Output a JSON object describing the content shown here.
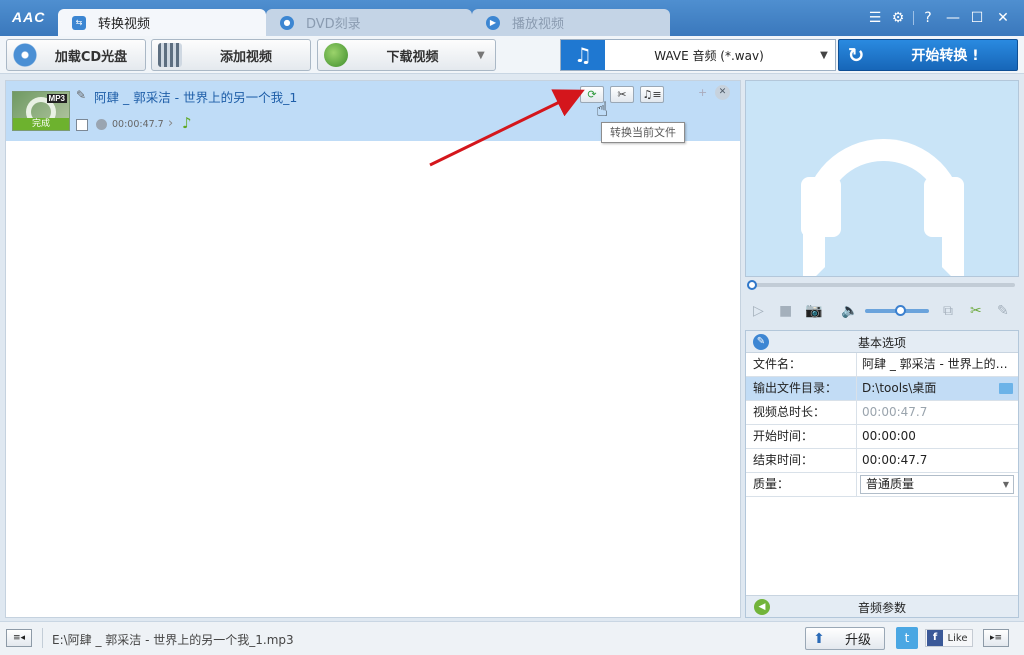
{
  "app": {
    "logo": "AAC"
  },
  "tabs": [
    {
      "label": "转换视频",
      "active": true
    },
    {
      "label": "DVD刻录",
      "active": false
    },
    {
      "label": "播放视频",
      "active": false
    }
  ],
  "window_controls": {
    "menu_glyph": "☰",
    "settings_glyph": "⚙",
    "help_glyph": "?",
    "minimize_glyph": "—",
    "maximize_glyph": "☐",
    "close_glyph": "✕"
  },
  "toolbar": {
    "load_cd_label": "加载CD光盘",
    "add_video_label": "添加视频",
    "download_video_label": "下载视频",
    "format_icon": "♫",
    "format_selected": "WAVE 音频 (*.wav)",
    "start_icon": "↻",
    "start_label": "开始转换 !"
  },
  "file_item": {
    "title": "阿肆 _ 郭采洁 - 世界上的另一个我_1",
    "format_badge": "MP3",
    "status": "完成",
    "duration": "00:00:47.7",
    "buttons": {
      "convert_glyph": "⟳",
      "cut_glyph": "✂",
      "audio_glyph": "♫≡",
      "add_glyph": "+",
      "close_glyph": "✕"
    },
    "tooltip": "转换当前文件"
  },
  "player": {
    "play_glyph": "▷",
    "stop_glyph": "■",
    "snapshot_glyph": "📷",
    "volume_glyph": "🔈",
    "volume_level": 0.55
  },
  "properties": {
    "header": "基本选项",
    "rows": [
      {
        "key": "文件名：",
        "value": "阿肆 _ 郭采洁 - 世界上的…",
        "selected": false,
        "dim": false
      },
      {
        "key": "输出文件目录：",
        "value": "D:\\tools\\桌面",
        "selected": true,
        "dim": false
      },
      {
        "key": "视频总时长：",
        "value": "00:00:47.7",
        "selected": false,
        "dim": true
      },
      {
        "key": "开始时间：",
        "value": "00:00:00",
        "selected": false,
        "dim": false
      },
      {
        "key": "结束时间：",
        "value": "00:00:47.7",
        "selected": false,
        "dim": false
      }
    ],
    "quality_key": "质量：",
    "quality_value": "普通质量",
    "audio_params": "音频参数"
  },
  "statusbar": {
    "path": "E:\\阿肆 _ 郭采洁 - 世界上的另一个我_1.mp3",
    "upgrade_label": "升级",
    "twitter_glyph": "t",
    "like_label": "Like",
    "like_glyph": "f"
  },
  "colors": {
    "title_bar": "#3a78bc",
    "accent_blue": "#1f78d1",
    "selected_row": "#bfdcf7",
    "status_green": "#6db22e"
  }
}
